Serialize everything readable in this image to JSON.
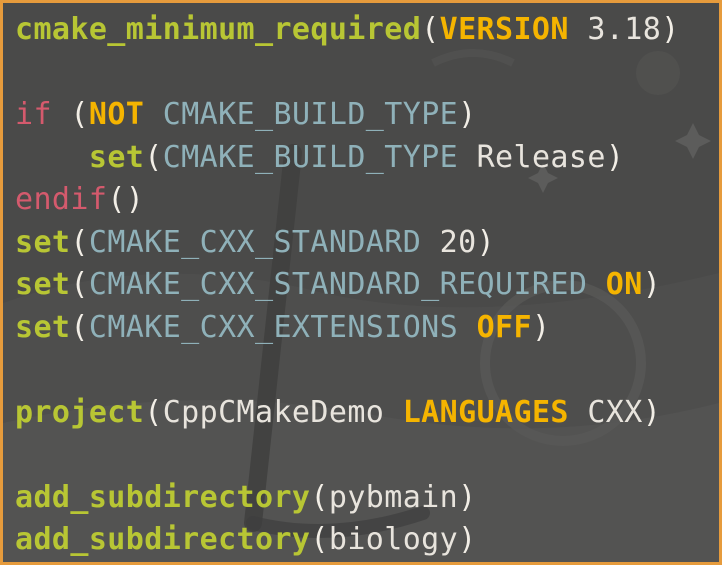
{
  "colors": {
    "frame_border": "#e69b3c",
    "background": "#4a4a49",
    "command": "#b8c634",
    "control": "#d45a6d",
    "keyword": "#f5b400",
    "variable": "#8fb1b9",
    "text": "#e8e4dd"
  },
  "code_lines": [
    {
      "tokens": [
        {
          "t": "cmake_minimum_required",
          "k": "cmd"
        },
        {
          "t": "(",
          "k": "par"
        },
        {
          "t": "VERSION",
          "k": "kw"
        },
        {
          "t": " 3.18",
          "k": "txt"
        },
        {
          "t": ")",
          "k": "par"
        }
      ]
    },
    {
      "tokens": []
    },
    {
      "tokens": [
        {
          "t": "if",
          "k": "ctl"
        },
        {
          "t": " (",
          "k": "par"
        },
        {
          "t": "NOT",
          "k": "kw"
        },
        {
          "t": " CMAKE_BUILD_TYPE",
          "k": "var"
        },
        {
          "t": ")",
          "k": "par"
        }
      ]
    },
    {
      "tokens": [
        {
          "t": "    ",
          "k": "txt"
        },
        {
          "t": "set",
          "k": "cmd"
        },
        {
          "t": "(",
          "k": "par"
        },
        {
          "t": "CMAKE_BUILD_TYPE",
          "k": "var"
        },
        {
          "t": " Release",
          "k": "txt"
        },
        {
          "t": ")",
          "k": "par"
        }
      ]
    },
    {
      "tokens": [
        {
          "t": "endif",
          "k": "ctl"
        },
        {
          "t": "()",
          "k": "par"
        }
      ]
    },
    {
      "tokens": [
        {
          "t": "set",
          "k": "cmd"
        },
        {
          "t": "(",
          "k": "par"
        },
        {
          "t": "CMAKE_CXX_STANDARD",
          "k": "var"
        },
        {
          "t": " 20",
          "k": "txt"
        },
        {
          "t": ")",
          "k": "par"
        }
      ]
    },
    {
      "tokens": [
        {
          "t": "set",
          "k": "cmd"
        },
        {
          "t": "(",
          "k": "par"
        },
        {
          "t": "CMAKE_CXX_STANDARD_REQUIRED",
          "k": "var"
        },
        {
          "t": " ",
          "k": "txt"
        },
        {
          "t": "ON",
          "k": "kw"
        },
        {
          "t": ")",
          "k": "par"
        }
      ]
    },
    {
      "tokens": [
        {
          "t": "set",
          "k": "cmd"
        },
        {
          "t": "(",
          "k": "par"
        },
        {
          "t": "CMAKE_CXX_EXTENSIONS",
          "k": "var"
        },
        {
          "t": " ",
          "k": "txt"
        },
        {
          "t": "OFF",
          "k": "kw"
        },
        {
          "t": ")",
          "k": "par"
        }
      ]
    },
    {
      "tokens": []
    },
    {
      "tokens": [
        {
          "t": "project",
          "k": "cmd"
        },
        {
          "t": "(",
          "k": "par"
        },
        {
          "t": "CppCMakeDemo",
          "k": "txt"
        },
        {
          "t": " ",
          "k": "txt"
        },
        {
          "t": "LANGUAGES",
          "k": "kw"
        },
        {
          "t": " CXX",
          "k": "txt"
        },
        {
          "t": ")",
          "k": "par"
        }
      ]
    },
    {
      "tokens": []
    },
    {
      "tokens": [
        {
          "t": "add_subdirectory",
          "k": "cmd"
        },
        {
          "t": "(",
          "k": "par"
        },
        {
          "t": "pybmain",
          "k": "txt"
        },
        {
          "t": ")",
          "k": "par"
        }
      ]
    },
    {
      "tokens": [
        {
          "t": "add_subdirectory",
          "k": "cmd"
        },
        {
          "t": "(",
          "k": "par"
        },
        {
          "t": "biology",
          "k": "txt"
        },
        {
          "t": ")",
          "k": "par"
        }
      ]
    }
  ]
}
